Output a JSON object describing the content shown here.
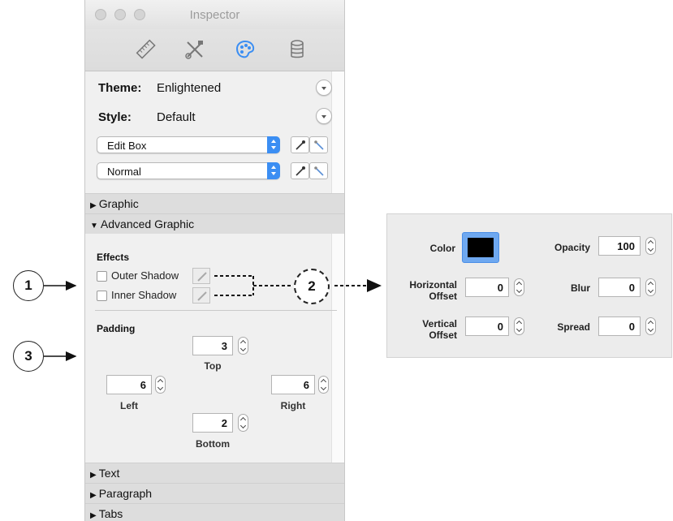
{
  "window": {
    "title": "Inspector"
  },
  "toolbar": {
    "icons": [
      "ruler-icon",
      "tools-icon",
      "palette-icon",
      "database-icon"
    ],
    "active_index": 2,
    "accent_color": "#3b8ef3"
  },
  "appearance": {
    "theme_label": "Theme:",
    "theme_value": "Enlightened",
    "style_label": "Style:",
    "style_value": "Default",
    "object_popup": "Edit Box",
    "state_popup": "Normal"
  },
  "sections": {
    "graphic": "Graphic",
    "advanced_graphic": "Advanced Graphic",
    "text": "Text",
    "paragraph": "Paragraph",
    "tabs": "Tabs"
  },
  "effects": {
    "heading": "Effects",
    "outer_shadow": "Outer Shadow",
    "inner_shadow": "Inner Shadow"
  },
  "padding": {
    "heading": "Padding",
    "top_value": "3",
    "top_label": "Top",
    "left_value": "6",
    "left_label": "Left",
    "right_value": "6",
    "right_label": "Right",
    "bottom_value": "2",
    "bottom_label": "Bottom"
  },
  "callouts": {
    "one": "1",
    "two": "2",
    "three": "3"
  },
  "shadow_panel": {
    "color_label": "Color",
    "color_value": "#000000",
    "opacity_label": "Opacity",
    "opacity_value": "100",
    "horizontal_offset_label": "Horizontal Offset",
    "horizontal_offset_value": "0",
    "blur_label": "Blur",
    "blur_value": "0",
    "vertical_offset_label": "Vertical Offset",
    "vertical_offset_value": "0",
    "spread_label": "Spread",
    "spread_value": "0"
  }
}
